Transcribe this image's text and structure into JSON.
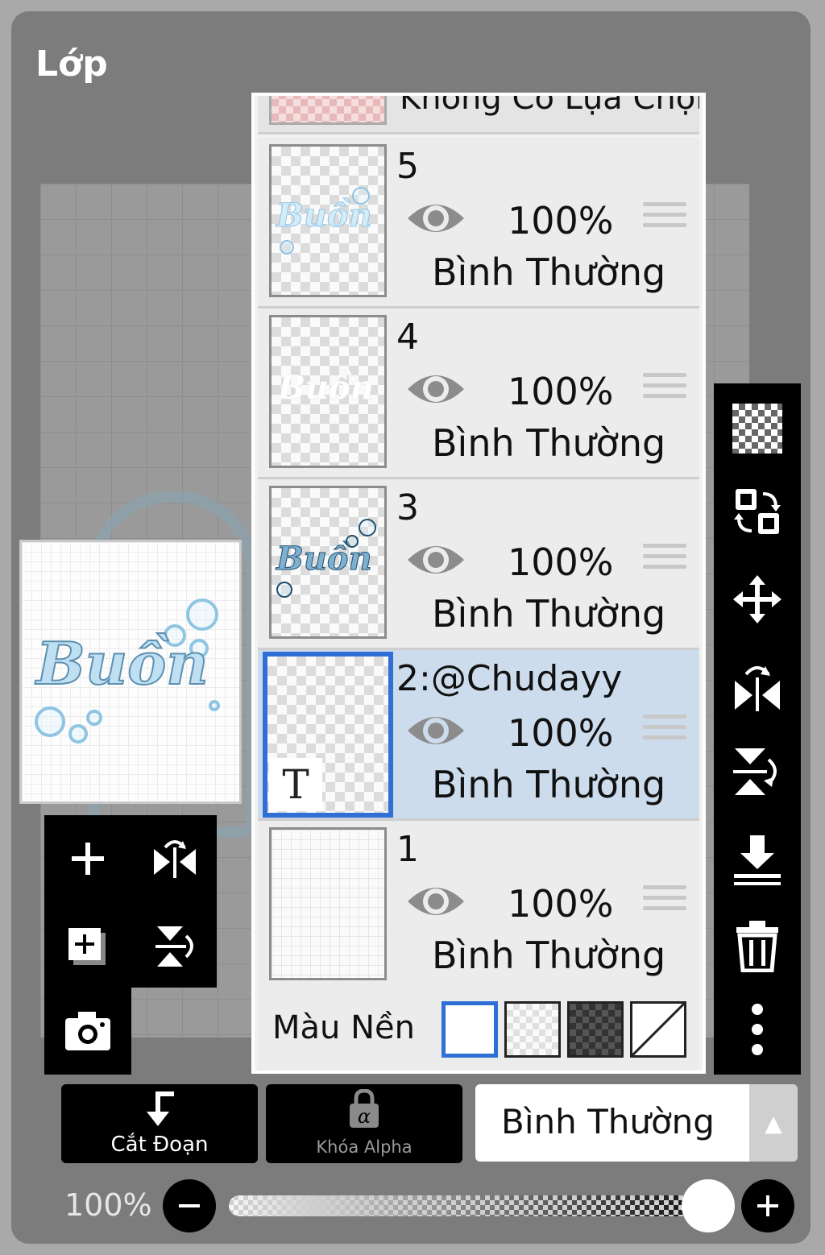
{
  "header": {
    "title": "Lớp"
  },
  "layer_list": {
    "partial_top_item": "Không Có Lựa Chọn",
    "layers": [
      {
        "name": "5",
        "opacity": "100%",
        "blend": "Bình Thường",
        "selected": false
      },
      {
        "name": "4",
        "opacity": "100%",
        "blend": "Bình Thường",
        "selected": false
      },
      {
        "name": "3",
        "opacity": "100%",
        "blend": "Bình Thường",
        "selected": false
      },
      {
        "name": "2:@Chudayy",
        "opacity": "100%",
        "blend": "Bình Thường",
        "selected": true,
        "type_badge": "T"
      },
      {
        "name": "1",
        "opacity": "100%",
        "blend": "Bình Thường",
        "selected": false
      }
    ],
    "background": {
      "label": "Màu Nền",
      "options": [
        "white",
        "light-checker",
        "dark-checker",
        "none"
      ],
      "selected": "white"
    }
  },
  "preview": {
    "art_text": "Buồn"
  },
  "left_toolbar": [
    "add-layer-icon",
    "flip-horizontal-icon",
    "add-copy-layer-icon",
    "flip-vertical-icon",
    "camera-icon"
  ],
  "right_toolbar": [
    "transparency-icon",
    "swap-layers-icon",
    "move-icon",
    "rotate-flip-horizontal-icon",
    "rotate-flip-vertical-icon",
    "merge-down-icon",
    "trash-icon",
    "more-icon"
  ],
  "bottom": {
    "clip_label": "Cắt Đoạn",
    "alpha_lock_label": "Khóa Alpha",
    "blend_mode": "Bình Thường"
  },
  "opacity": {
    "label": "100%",
    "value": 1.0
  },
  "colors": {
    "accent": "#2f6fd6",
    "selected_row": "#cddcec",
    "panel": "#7c7c7c"
  }
}
